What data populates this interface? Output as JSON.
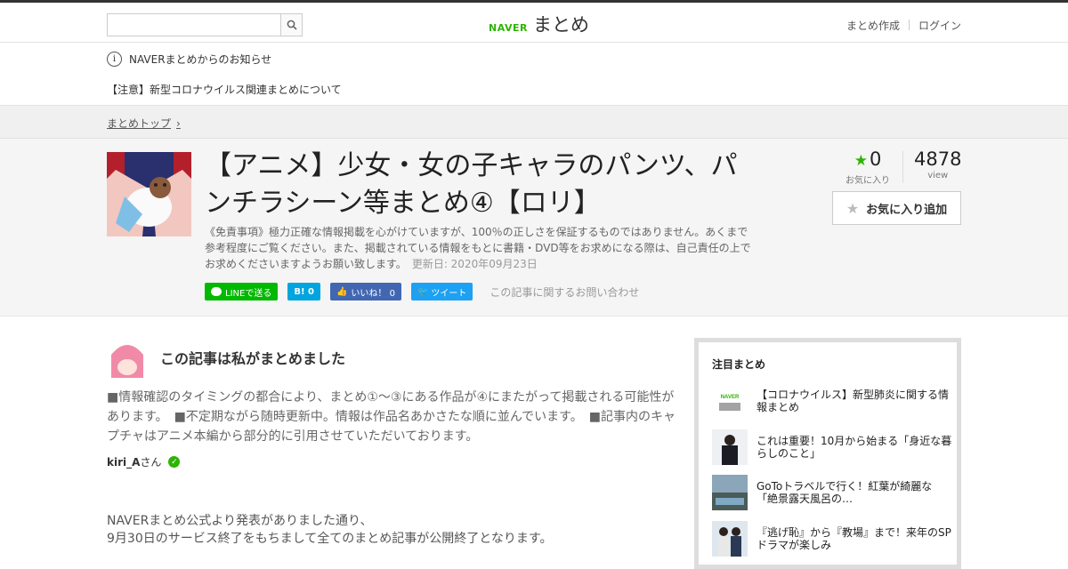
{
  "header": {
    "search_placeholder": "",
    "logo_brand": "NAVER",
    "logo_text": "まとめ",
    "create_link": "まとめ作成",
    "login_link": "ログイン"
  },
  "notice": {
    "heading": "NAVERまとめからのお知らせ",
    "link": "【注意】新型コロナウイルス関連まとめについて"
  },
  "breadcrumb": {
    "top": "まとめトップ"
  },
  "article": {
    "title": "【アニメ】少女・女の子キャラのパンツ、パンチラシーン等まとめ④【ロリ】",
    "disclaimer": "《免責事項》極力正確な情報掲載を心がけていますが、100％の正しさを保証するものではありません。あくまで参考程度にご覧ください。また、掲載されている情報をもとに書籍・DVD等をお求めになる際は、自己責任の上でお求めくださいますようお願い致します。",
    "updated": "更新日: 2020年09月23日",
    "favorites_count": "0",
    "favorites_label": "お気に入り",
    "views_count": "4878",
    "views_label": "view",
    "fav_button": "お気に入り追加"
  },
  "share": {
    "line": "LINEで送る",
    "hatena": "B! 0",
    "facebook": "いいね！ 0",
    "twitter": "ツイート",
    "inquiry": "この記事に関するお問い合わせ"
  },
  "author": {
    "heading": "この記事は私がまとめました",
    "description": "■情報確認のタイミングの都合により、まとめ①～③にある作品が④にまたがって掲載される可能性があります。　■不定期ながら随時更新中。情報は作品名あかさたな順に並んでいます。　■記事内のキャプチャはアニメ本編から部分的に引用させていただいております。",
    "name": "kiri_A",
    "suffix": "さん"
  },
  "body": {
    "line1": "NAVERまとめ公式より発表がありました通り、",
    "line2": "9月30日のサービス終了をもちまして全てのまとめ記事が公開終了となります。"
  },
  "sidebar": {
    "title": "注目まとめ",
    "items": [
      {
        "text": "【コロナウイルス】新型肺炎に関する情報まとめ",
        "thumb": "naver-logo"
      },
      {
        "text": "これは重要！10月から始まる「身近な暮らしのこと」",
        "thumb": "person-photo"
      },
      {
        "text": "GoToトラベルで行く！紅葉が綺麗な「絶景露天風呂の…",
        "thumb": "landscape-photo"
      },
      {
        "text": "『逃げ恥』から『教場』まで！来年のSPドラマが楽しみ",
        "thumb": "couple-photo"
      }
    ]
  },
  "colors": {
    "naver_green": "#2db400",
    "line_green": "#00b900",
    "hatena_blue": "#00a4de",
    "facebook_blue": "#4267b2",
    "twitter_blue": "#1da1f2"
  }
}
